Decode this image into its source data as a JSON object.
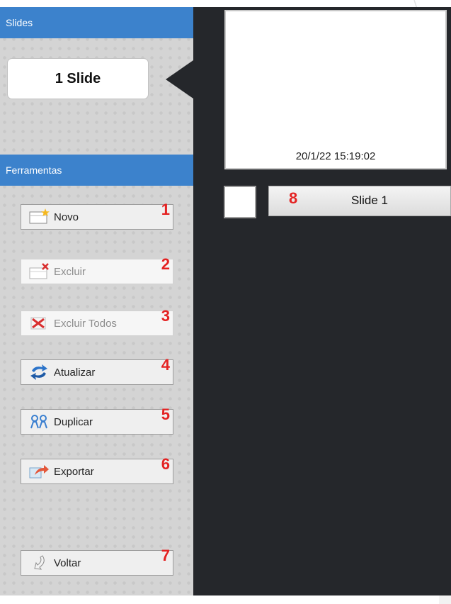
{
  "sidebar": {
    "slides_header": "Slides",
    "slide_counter": "1 Slide",
    "tools_header": "Ferramentas",
    "tools": [
      {
        "label": "Novo",
        "num": "1",
        "icon": "new-slide-icon",
        "enabled": true
      },
      {
        "label": "Excluir",
        "num": "2",
        "icon": "delete-slide-icon",
        "enabled": false
      },
      {
        "label": "Excluir Todos",
        "num": "3",
        "icon": "delete-all-icon",
        "enabled": false
      },
      {
        "label": "Atualizar",
        "num": "4",
        "icon": "refresh-icon",
        "enabled": true
      },
      {
        "label": "Duplicar",
        "num": "5",
        "icon": "duplicate-icon",
        "enabled": true
      },
      {
        "label": "Exportar",
        "num": "6",
        "icon": "export-icon",
        "enabled": true
      },
      {
        "label": "Voltar",
        "num": "7",
        "icon": "back-icon",
        "enabled": true
      }
    ]
  },
  "main": {
    "thumbnail_timestamp": "20/1/22 15:19:02",
    "slide_list": [
      {
        "label": "Slide 1",
        "num": "8"
      }
    ]
  },
  "colors": {
    "header_blue": "#3c82cc",
    "dark_background": "#25272b",
    "annotation_red": "#e42222"
  }
}
